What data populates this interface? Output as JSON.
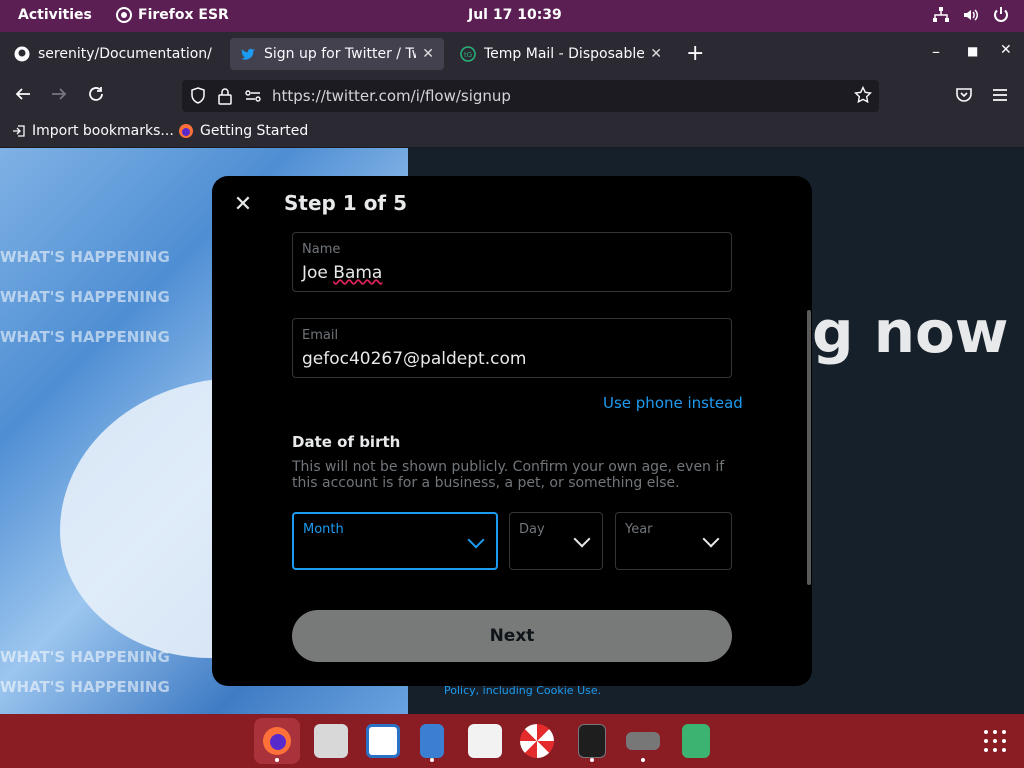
{
  "topbar": {
    "activities": "Activities",
    "app_name": "Firefox ESR",
    "clock": "Jul 17  10:39"
  },
  "tabs": [
    {
      "label": "serenity/Documentation/",
      "icon": "github-icon",
      "active": false
    },
    {
      "label": "Sign up for Twitter / Twitt",
      "icon": "twitter-icon",
      "active": true
    },
    {
      "label": "Temp Mail - Disposable Te",
      "icon": "tempmail-icon",
      "active": false
    }
  ],
  "nav": {
    "url": "https://twitter.com/i/flow/signup"
  },
  "bookmarks": [
    {
      "label": "Import bookmarks...",
      "icon": "import-icon"
    },
    {
      "label": "Getting Started",
      "icon": "firefox-icon"
    }
  ],
  "page": {
    "big_text": "g now",
    "policy_prefix": "Policy, including ",
    "policy_link": "Cookie Use",
    "policy_suffix": ".",
    "hero_text": "WHAT'S HAPPENING"
  },
  "modal": {
    "step": "Step 1 of 5",
    "name_label": "Name",
    "name_value": "Joe Bama",
    "email_label": "Email",
    "email_value": "gefoc40267@paldept.com",
    "phone_link": "Use phone instead",
    "dob_heading": "Date of birth",
    "dob_text": "This will not be shown publicly. Confirm your own age, even if this account is for a business, a pet, or something else.",
    "month_label": "Month",
    "day_label": "Day",
    "year_label": "Year",
    "next_label": "Next"
  },
  "colors": {
    "accent": "#1d9bf0",
    "topbar": "#5b1f54",
    "dock": "#8a1c24",
    "browser_chrome": "#2b2a33"
  }
}
